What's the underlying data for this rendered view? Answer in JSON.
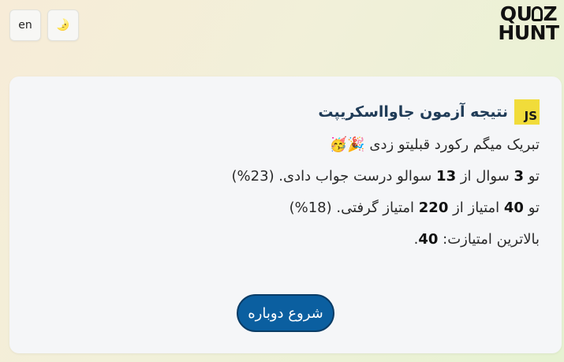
{
  "header": {
    "lang_button": "en",
    "theme_icon": "🌛",
    "logo_line1": "QU",
    "logo_line1_end": "Z",
    "logo_line2": "HUNT"
  },
  "result": {
    "badge": "JS",
    "title": "نتیجه آزمون جاوااسکریپت",
    "congrats": "تبریک میگم رکورد قبلیتو زدی 🎉🥳",
    "q_pre": "تو ",
    "q_correct": "3",
    "q_mid": " سوال از ",
    "q_total": "13",
    "q_post": " سوالو درست جواب دادی. (23%)",
    "s_pre": "تو ",
    "s_points": "40",
    "s_mid": " امتیاز از ",
    "s_total": "220",
    "s_post": " امتیاز گرفتی. (18%)",
    "best_pre": "بالاترین امتیازت: ",
    "best_value": "40",
    "best_post": ".",
    "restart_label": "شروع دوباره"
  }
}
